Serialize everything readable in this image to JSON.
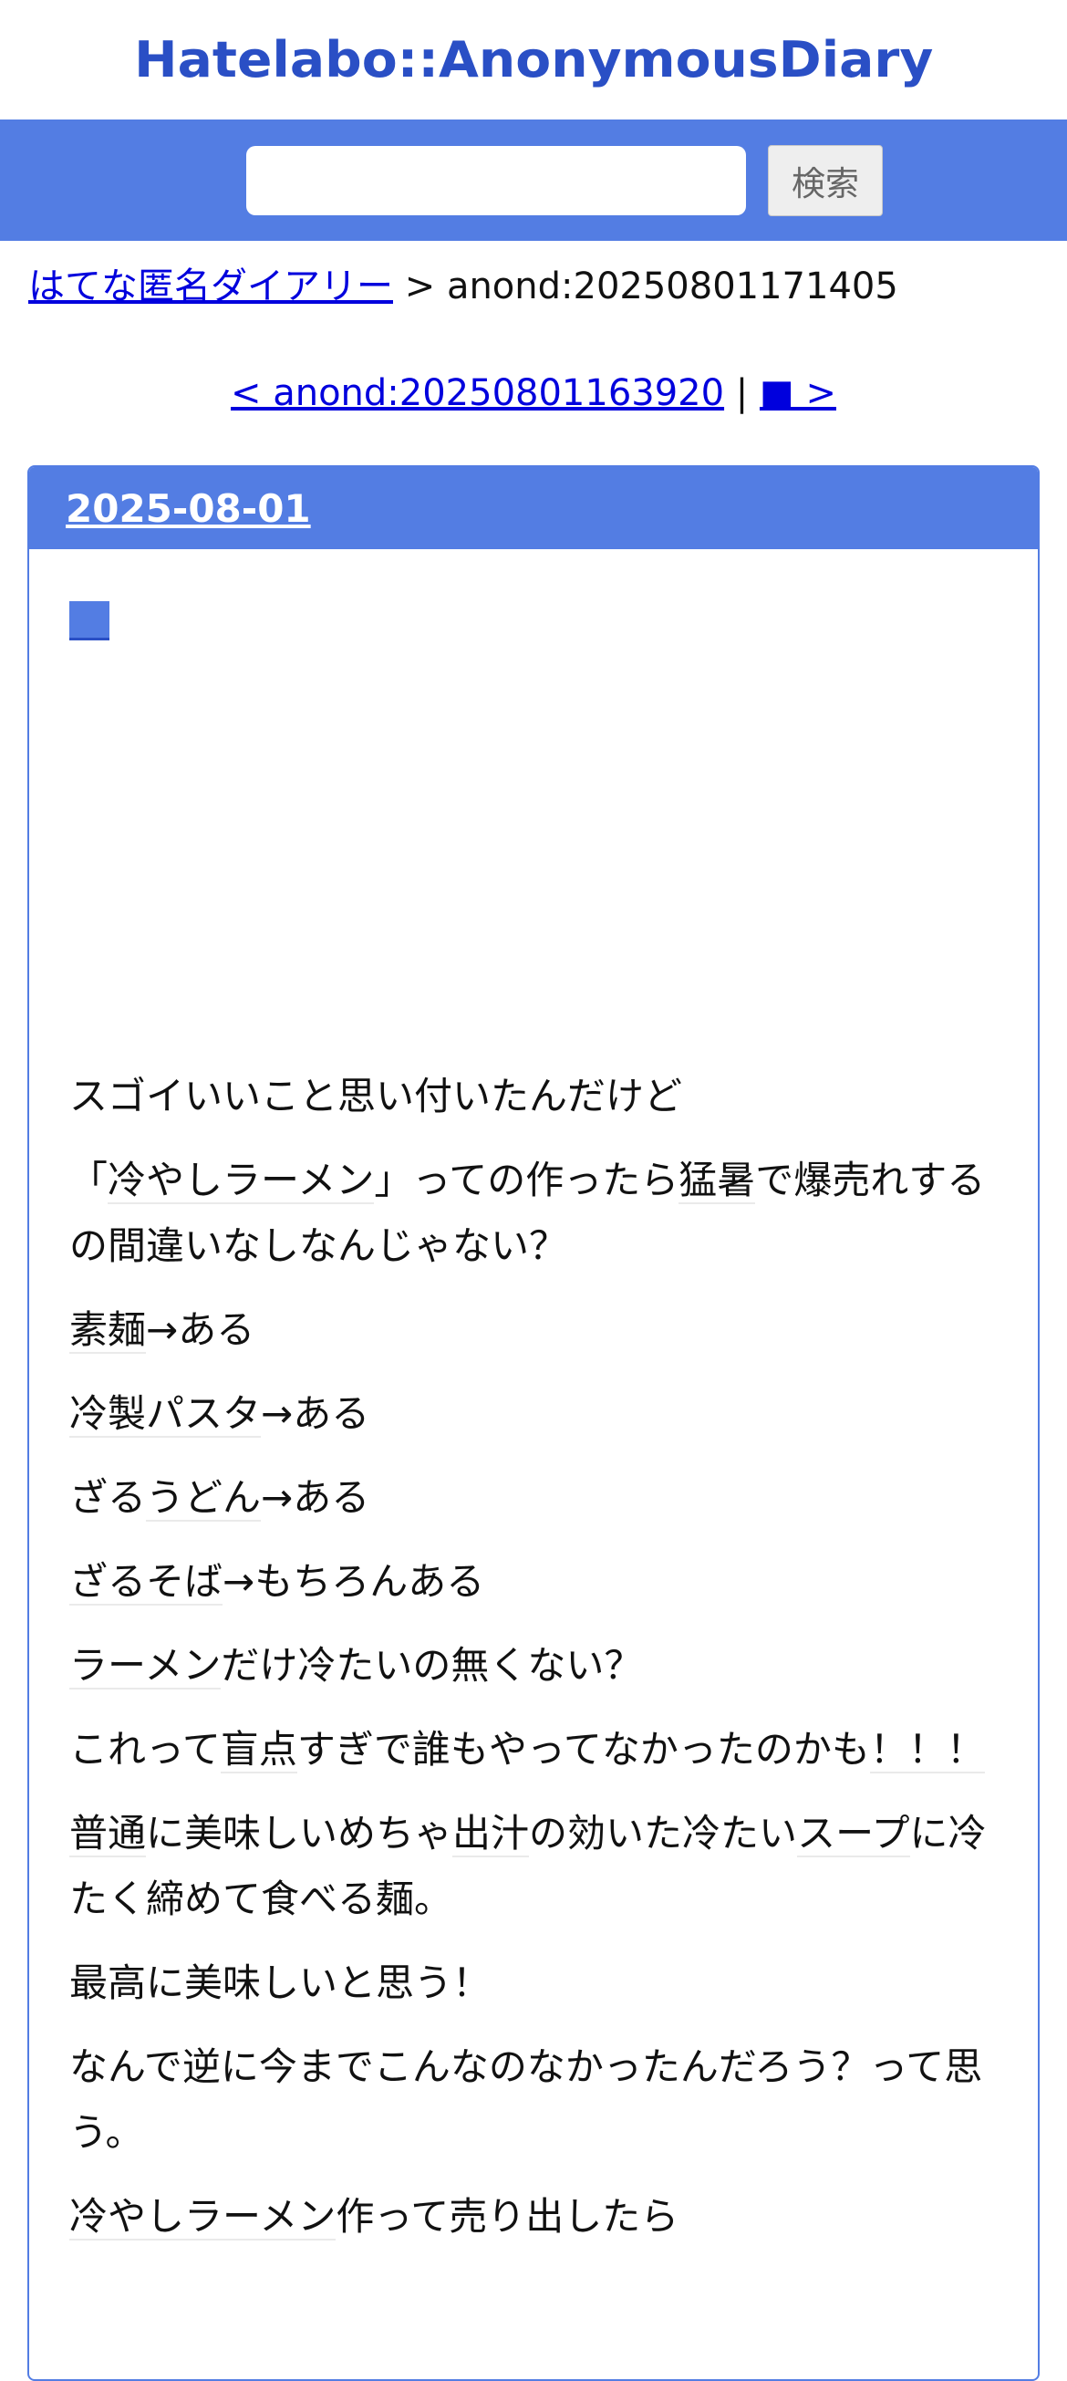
{
  "header": {
    "site_title": "Hatelabo::AnonymousDiary"
  },
  "search": {
    "input_value": "",
    "button_label": "検索"
  },
  "breadcrumb": {
    "home_link": "はてな匿名ダイアリー",
    "separator_current": " > anond:20250801171405"
  },
  "pager": {
    "prev_link": "< anond:20250801163920",
    "separator": " | ",
    "next_link": "■ >"
  },
  "entry": {
    "date": "2025-08-01",
    "anchor_icon": "blue-square",
    "paragraphs": [
      [
        {
          "t": "スゴイいいこと思い付いたんだけど"
        }
      ],
      [
        {
          "t": "「"
        },
        {
          "t": "冷やしラーメン",
          "kw": true
        },
        {
          "t": "」っての作ったら"
        },
        {
          "t": "猛暑",
          "kw": true
        },
        {
          "t": "で爆売れするの間違いなしなんじゃない？"
        }
      ],
      [
        {
          "t": "素麺",
          "kw": true
        },
        {
          "t": "→ある"
        }
      ],
      [
        {
          "t": "冷製パスタ",
          "kw": true
        },
        {
          "t": "→ある"
        }
      ],
      [
        {
          "t": "ざる"
        },
        {
          "t": "うどん",
          "kw": true
        },
        {
          "t": "→ある"
        }
      ],
      [
        {
          "t": "ざるそば",
          "kw": true
        },
        {
          "t": "→もちろんある"
        }
      ],
      [
        {
          "t": "ラーメン",
          "kw": true
        },
        {
          "t": "だけ冷たいの無くない？"
        }
      ],
      [
        {
          "t": "これって"
        },
        {
          "t": "盲点",
          "kw": true
        },
        {
          "t": "すぎで誰もやってなかったのかも"
        },
        {
          "t": "！！！",
          "kw": true
        }
      ],
      [
        {
          "t": "普通",
          "kw": true
        },
        {
          "t": "に美味しいめちゃ"
        },
        {
          "t": "出汁",
          "kw": true
        },
        {
          "t": "の効いた冷たい"
        },
        {
          "t": "スープ",
          "kw": true
        },
        {
          "t": "に冷たく締めて食べる麺。"
        }
      ],
      [
        {
          "t": "最高に美味しいと思う！"
        }
      ],
      [
        {
          "t": "なんで逆に今までこんなのなかったんだろう？って思う。"
        }
      ],
      [
        {
          "t": "冷やしラーメン",
          "kw": true
        },
        {
          "t": "作って売り出したら"
        }
      ]
    ]
  },
  "colors": {
    "brand_blue": "#537de3",
    "title_blue": "#2a4fc5",
    "link_blue": "#0000dd"
  }
}
